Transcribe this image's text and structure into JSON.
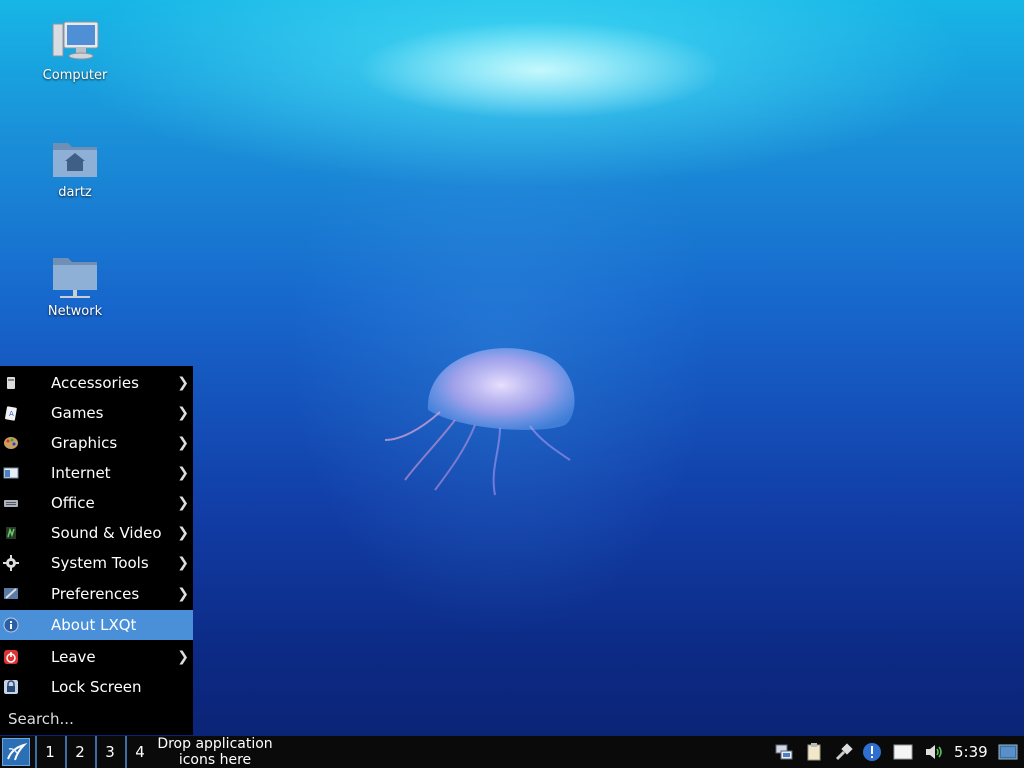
{
  "desktop_icons": [
    {
      "label": "Computer",
      "icon": "computer-icon"
    },
    {
      "label": "dartz",
      "icon": "home-folder-icon"
    },
    {
      "label": "Network",
      "icon": "network-folder-icon"
    }
  ],
  "menu": {
    "items": [
      {
        "label": "Accessories",
        "icon": "accessories-icon",
        "submenu": true
      },
      {
        "label": "Games",
        "icon": "games-icon",
        "submenu": true
      },
      {
        "label": "Graphics",
        "icon": "graphics-icon",
        "submenu": true
      },
      {
        "label": "Internet",
        "icon": "internet-icon",
        "submenu": true
      },
      {
        "label": "Office",
        "icon": "office-icon",
        "submenu": true
      },
      {
        "label": "Sound & Video",
        "icon": "sound-video-icon",
        "submenu": true
      },
      {
        "label": "System Tools",
        "icon": "gear-icon",
        "submenu": true
      },
      {
        "label": "Preferences",
        "icon": "preferences-icon",
        "submenu": true
      },
      {
        "label": "About LXQt",
        "icon": "info-icon",
        "submenu": false,
        "active": true
      },
      {
        "label": "Leave",
        "icon": "power-icon",
        "submenu": true
      },
      {
        "label": "Lock Screen",
        "icon": "lock-icon",
        "submenu": false
      }
    ],
    "search_placeholder": "Search..."
  },
  "taskbar": {
    "start_icon": "lxqt-start-icon",
    "desktops": [
      "1",
      "2",
      "3",
      "4"
    ],
    "quicklaunch_text_line1": "Drop application",
    "quicklaunch_text_line2": "icons here",
    "tray_icons": [
      "network-manager-icon",
      "clipboard-icon",
      "removable-media-icon",
      "update-notifier-icon",
      "notes-icon",
      "volume-icon",
      "show-desktop-icon"
    ],
    "clock": "5:39"
  },
  "colors": {
    "menu_background": "#000000",
    "menu_active": "#4a90d9",
    "taskbar_background": "#0a0a0a",
    "desktop_separator": "#3a6ea5"
  }
}
